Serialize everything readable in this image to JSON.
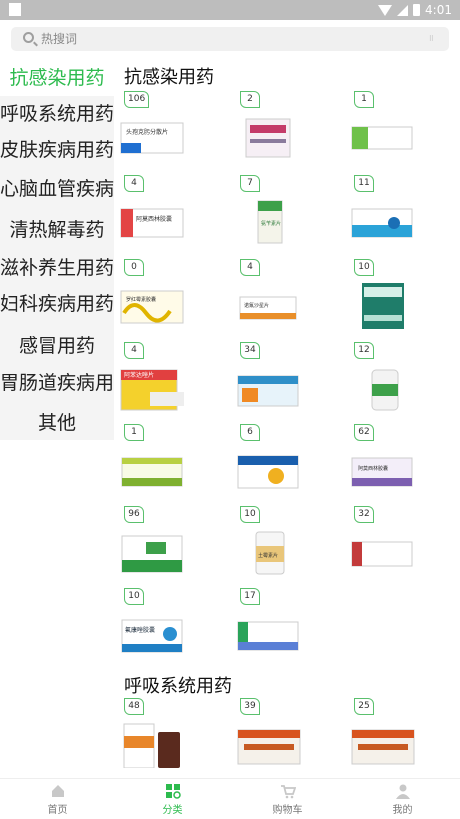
{
  "search": {
    "placeholder": "热搜词"
  },
  "status": {
    "time": "4:01"
  },
  "categories": [
    {
      "label": "抗感染用药"
    },
    {
      "label": "呼吸系统用药"
    },
    {
      "label": "皮肤疾病用药"
    },
    {
      "label": "心脑血管疾病用药"
    },
    {
      "label": "清热解毒药"
    },
    {
      "label": "滋补养生用药"
    },
    {
      "label": "妇科疾病用药"
    },
    {
      "label": "感冒用药"
    },
    {
      "label": "胃肠道疾病用药"
    },
    {
      "label": "其他"
    }
  ],
  "sections": [
    {
      "title": "抗感染用药",
      "products": [
        {
          "count": "106",
          "pack_text": "头孢克肟分散片"
        },
        {
          "count": "2",
          "pack_text": ""
        },
        {
          "count": "1",
          "pack_text": ""
        },
        {
          "count": "4",
          "pack_text": "阿莫西林胶囊"
        },
        {
          "count": "7",
          "pack_text": "氨苄素片"
        },
        {
          "count": "11",
          "pack_text": ""
        },
        {
          "count": "0",
          "pack_text": "罗红霉素胶囊"
        },
        {
          "count": "4",
          "pack_text": "诺氟沙星片"
        },
        {
          "count": "10",
          "pack_text": ""
        },
        {
          "count": "4",
          "pack_text": "阿苯达唑片"
        },
        {
          "count": "34",
          "pack_text": ""
        },
        {
          "count": "12",
          "pack_text": ""
        },
        {
          "count": "1",
          "pack_text": ""
        },
        {
          "count": "6",
          "pack_text": ""
        },
        {
          "count": "62",
          "pack_text": "阿莫西林胶囊"
        },
        {
          "count": "96",
          "pack_text": ""
        },
        {
          "count": "10",
          "pack_text": "土霉素片"
        },
        {
          "count": "32",
          "pack_text": ""
        },
        {
          "count": "10",
          "pack_text": "氟康唑胶囊"
        },
        {
          "count": "17",
          "pack_text": ""
        }
      ]
    },
    {
      "title": "呼吸系统用药",
      "products": [
        {
          "count": "48",
          "pack_text": ""
        },
        {
          "count": "39",
          "pack_text": ""
        },
        {
          "count": "25",
          "pack_text": ""
        }
      ]
    }
  ],
  "tabs": [
    {
      "label": "首页"
    },
    {
      "label": "分类"
    },
    {
      "label": "购物车"
    },
    {
      "label": "我的"
    }
  ],
  "colors": {
    "accent": "#2dbb4e",
    "sidebar_bg": "#f4f4f4",
    "statusbar": "#bdbdbd"
  }
}
